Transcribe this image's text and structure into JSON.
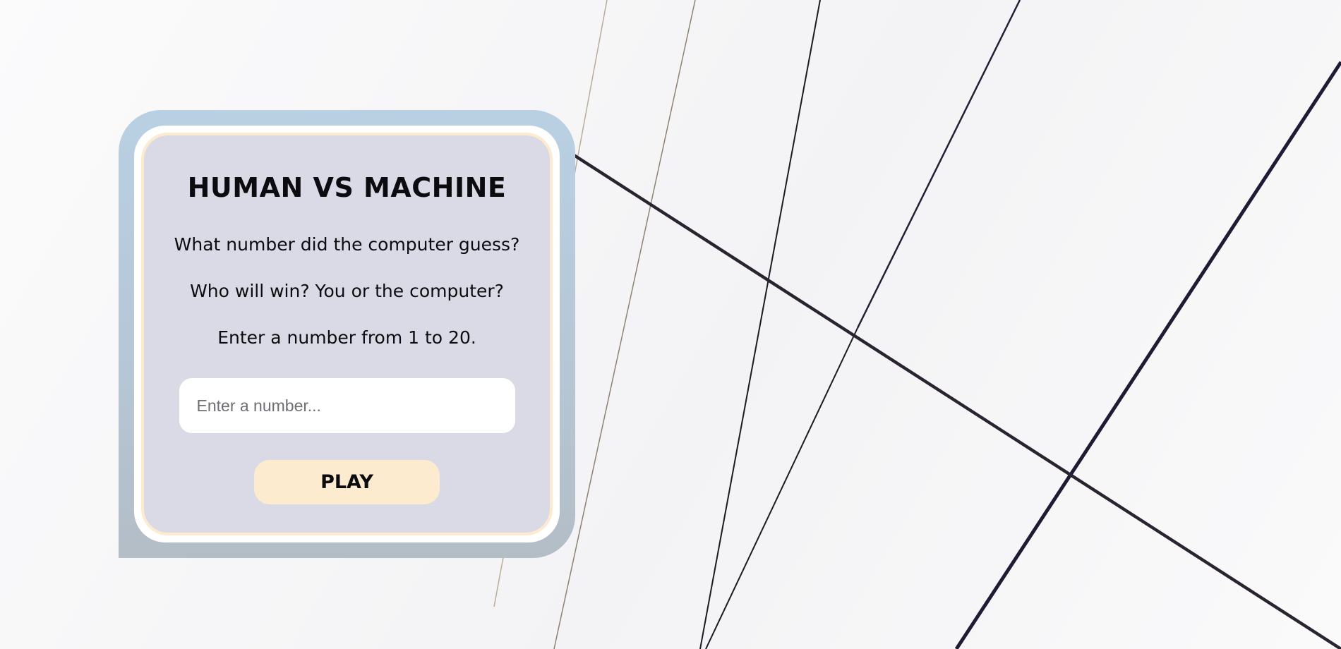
{
  "game": {
    "title": "HUMAN VS MACHINE",
    "lines": [
      "What number did the computer guess?",
      "Who will win? You or the computer?",
      "Enter a number from 1 to 20."
    ],
    "input": {
      "value": "",
      "placeholder": "Enter a number..."
    },
    "play_label": "PLAY"
  },
  "colors": {
    "frame": "#b9d0e3",
    "panel": "#dadae6",
    "accent": "#fdebd0",
    "text": "#0c0c10"
  }
}
